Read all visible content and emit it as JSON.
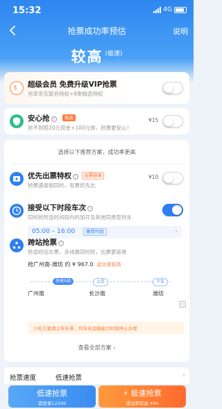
{
  "status_bar": {
    "time": "15:32",
    "network": "4G"
  },
  "nav": {
    "title": "抢票成功率预估",
    "help": "说明"
  },
  "rate": {
    "value": "较高",
    "tag": "(极速)"
  },
  "vip_card": {
    "title": "超级会员 免费升级VIP抢票",
    "subtitle": "另享京东联名特权+8类精选特权",
    "enabled": false
  },
  "safe_card": {
    "title": "安心抢",
    "badge": "热卖",
    "subtitle": "抢不到赔20元现金+100元券，抢票更安心！",
    "price": "¥15",
    "enabled": false
  },
  "plan": {
    "tip": "选择以下推荐方案，成功率更高",
    "priority": {
      "title": "优先出票特权",
      "badge": "出票容易",
      "subtitle": "抢票速度相同时，有票优先出",
      "price": "¥10",
      "enabled": false
    },
    "time_slot": {
      "title": "接受以下时段车次",
      "subtitle": "同时抢所选时间段内的加开及其他同类型列车",
      "range": "05:00 – 16:00",
      "recommend": "推荐时段",
      "enabled": true
    },
    "cross": {
      "title": "跨站抢票",
      "subtitle": "抢途经站车票，多线路同时抢，出票更容易",
      "route": "抢广州南-潍坊 约 ¥ 967.0",
      "success": "成功率较高",
      "pills": [
        "多抢5站",
        "上车",
        "下车"
      ],
      "stations": [
        "广州南",
        "长沙南",
        "潍坊"
      ],
      "warning": "少检方案请上车补票，列车无运输能力时按停止办理"
    },
    "see_all": "查看全部方案 ›"
  },
  "speed": {
    "label": "抢票速度",
    "value": "低速抢票"
  },
  "buttons": {
    "slow": {
      "label": "低速抢票",
      "sub": "需登录12306"
    },
    "fast": {
      "label": "极速抢票",
      "sub": "成功率较高 ¥40"
    }
  },
  "colors": {
    "primary": "#2f7ff0",
    "accent": "#ff7b3a"
  }
}
